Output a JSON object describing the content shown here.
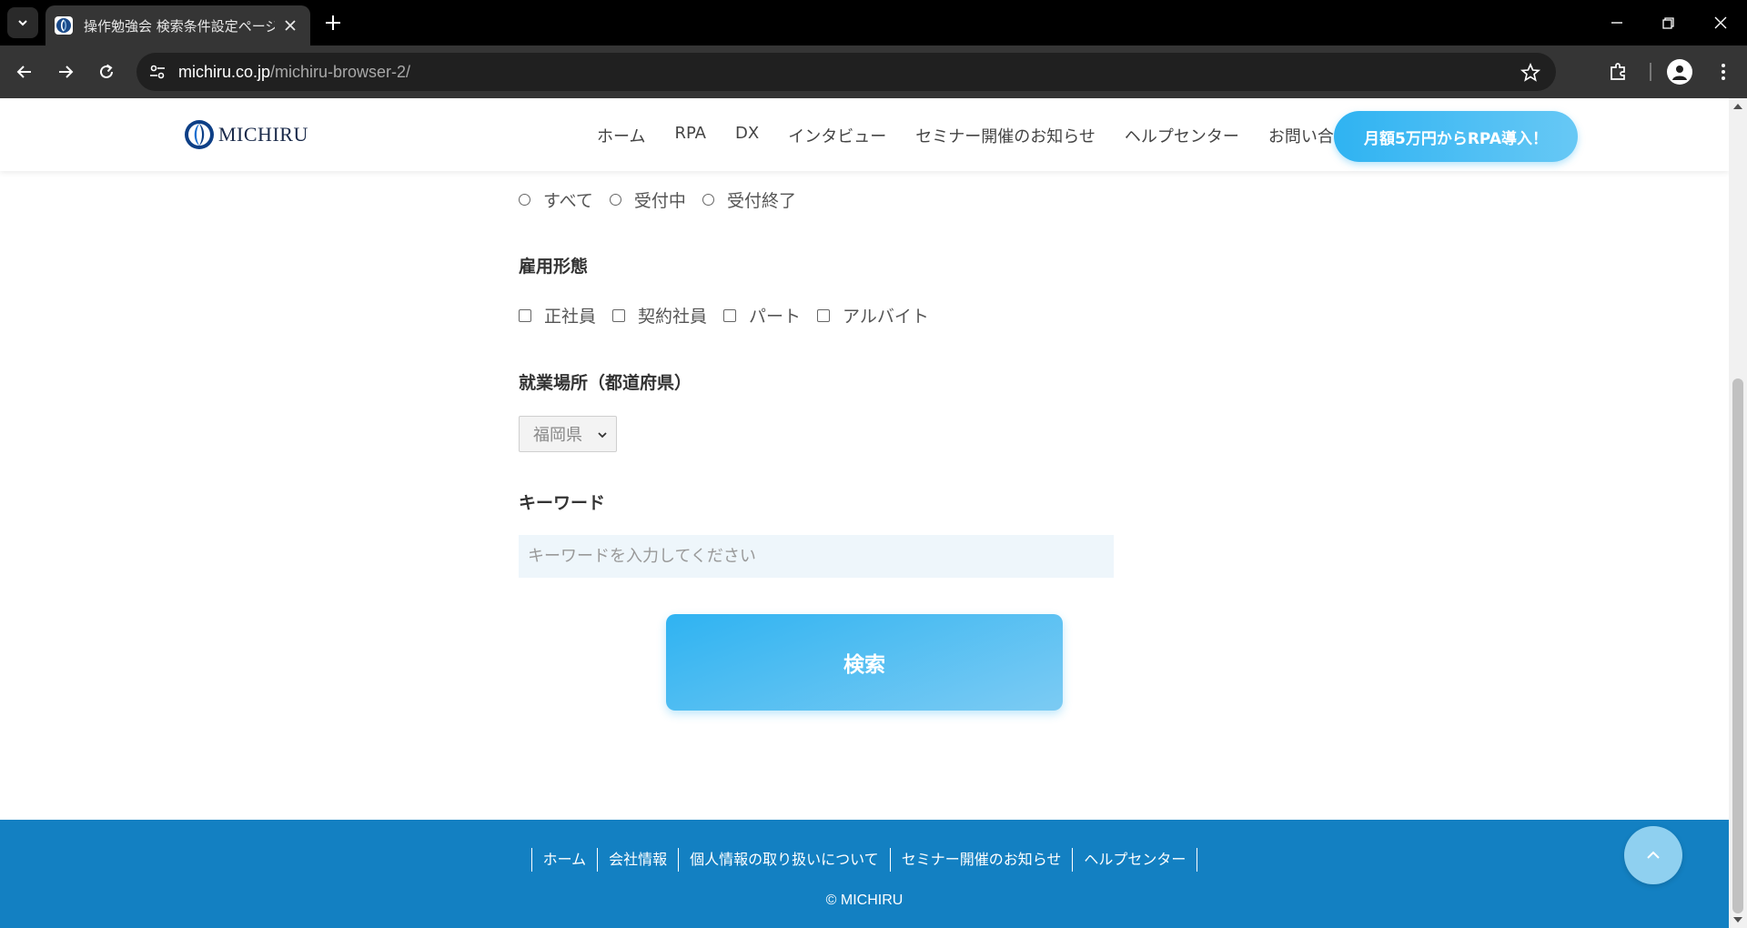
{
  "browser": {
    "tab": {
      "title": "操作勉強会 検索条件設定ページ",
      "favicon": "michiru-logo-icon"
    },
    "url": {
      "host": "michiru.co.jp",
      "path": "/michiru-browser-2/"
    },
    "icons": {
      "tab_list": "chevron-down-icon",
      "close_tab": "close-icon",
      "new_tab": "plus-icon",
      "back": "arrow-left-icon",
      "forward": "arrow-right-icon",
      "reload": "reload-icon",
      "site_info": "tune-icon",
      "bookmark": "star-icon",
      "extensions": "puzzle-icon",
      "profile": "person-icon",
      "menu": "kebab-icon",
      "minimize": "minimize-icon",
      "restore": "restore-icon",
      "close_window": "close-icon"
    }
  },
  "site": {
    "logo_text": "MICHIRU",
    "nav": [
      "ホーム",
      "RPA",
      "DX",
      "インタビュー",
      "セミナー開催のお知らせ",
      "ヘルプセンター",
      "お問い合せ"
    ],
    "cta_label": "月額5万円からRPA導入！",
    "accent_color": "#2fb3f2",
    "footer_color": "#1380c2"
  },
  "form": {
    "status": {
      "options": [
        "すべて",
        "受付中",
        "受付終了"
      ]
    },
    "employment": {
      "label": "雇用形態",
      "options": [
        "正社員",
        "契約社員",
        "パート",
        "アルバイト"
      ]
    },
    "location": {
      "label": "就業場所（都道府県）",
      "selected": "福岡県"
    },
    "keyword": {
      "label": "キーワード",
      "placeholder": "キーワードを入力してください",
      "value": ""
    },
    "search_label": "検索"
  },
  "footer": {
    "links": [
      "ホーム",
      "会社情報",
      "個人情報の取り扱いについて",
      "セミナー開催のお知らせ",
      "ヘルプセンター"
    ],
    "copyright": "© MICHIRU"
  }
}
